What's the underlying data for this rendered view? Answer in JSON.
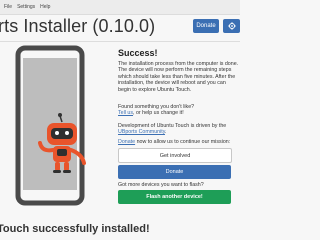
{
  "menu": {
    "items": [
      "File",
      "Settings",
      "Help"
    ]
  },
  "header": {
    "title": "rts Installer (0.10.0)",
    "donate_label": "Donate",
    "settings_icon": "gear-icon"
  },
  "illustration": {
    "phone_icon": "phone-outline-icon",
    "robot_icon": "robot-mascot-icon",
    "robot_color": "#e9542b"
  },
  "main": {
    "title": "Success!",
    "description": "The installation process from the computer is done. The device will now perform the remaining steps which should take less than five minutes. After the installation, the device will reboot and you can begin to explore Ubuntu Touch.",
    "dislike_prefix": "Found something you don't like?",
    "tell_us_link": "Tell us",
    "dislike_suffix": ", or help us change it!",
    "dev_prefix": "Development of Ubuntu Touch is driven by the ",
    "ubports_link": "UBports Community",
    "donate_link": "Donate",
    "donate_suffix": " now to allow us to continue our mission:",
    "get_involved_label": "Get involved",
    "donate_button_label": "Donate",
    "more_devices_text": "Got more devices you want to flash?",
    "flash_another_label": "Flash another device!"
  },
  "status": {
    "text": "Touch successfully installed!"
  },
  "colors": {
    "primary": "#3b6fb3",
    "success": "#1e9e57",
    "accent": "#e9542b"
  }
}
